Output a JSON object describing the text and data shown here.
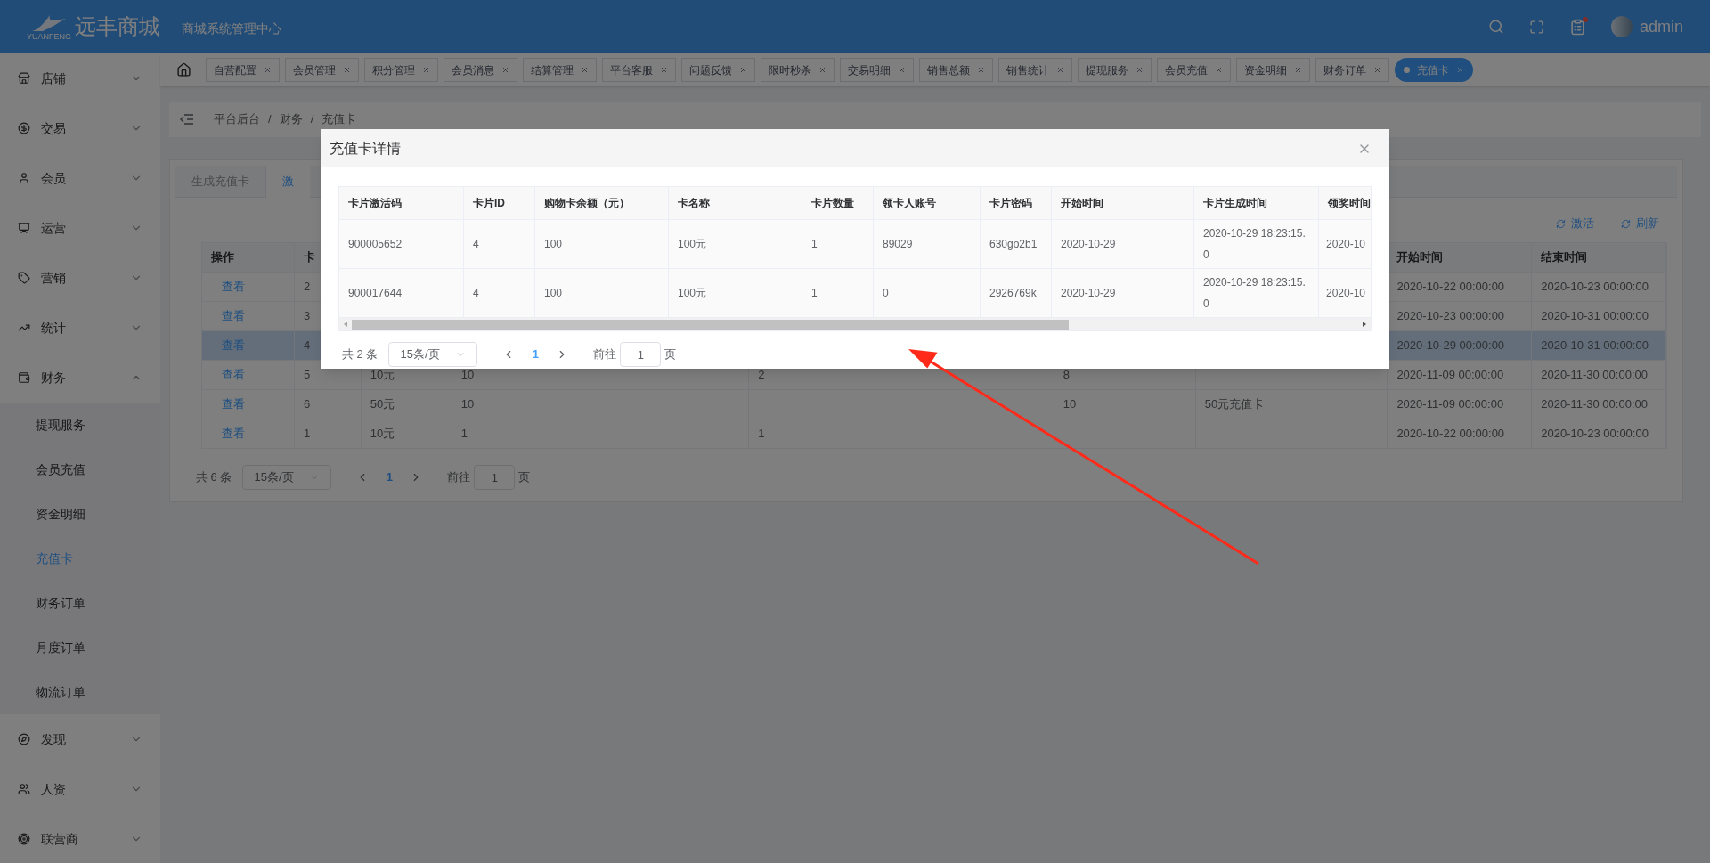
{
  "header": {
    "logo_caption": "YUANFENG",
    "logo_text": "远丰商城",
    "subtitle": "商城系统管理中心",
    "user": "admin",
    "has_notification": true
  },
  "tabs": [
    {
      "label": "自营配置",
      "selected": false
    },
    {
      "label": "会员管理",
      "selected": false
    },
    {
      "label": "积分管理",
      "selected": false
    },
    {
      "label": "会员消息",
      "selected": false
    },
    {
      "label": "结算管理",
      "selected": false
    },
    {
      "label": "平台客服",
      "selected": false
    },
    {
      "label": "问题反馈",
      "selected": false
    },
    {
      "label": "限时秒杀",
      "selected": false
    },
    {
      "label": "交易明细",
      "selected": false
    },
    {
      "label": "销售总额",
      "selected": false
    },
    {
      "label": "销售统计",
      "selected": false
    },
    {
      "label": "提现服务",
      "selected": false
    },
    {
      "label": "会员充值",
      "selected": false
    },
    {
      "label": "资金明细",
      "selected": false
    },
    {
      "label": "财务订单",
      "selected": false
    },
    {
      "label": "充值卡",
      "selected": true
    }
  ],
  "sidebar": [
    {
      "label": "店铺",
      "expanded": false
    },
    {
      "label": "交易",
      "expanded": false
    },
    {
      "label": "会员",
      "expanded": false
    },
    {
      "label": "运营",
      "expanded": false
    },
    {
      "label": "营销",
      "expanded": false
    },
    {
      "label": "统计",
      "expanded": false
    },
    {
      "label": "财务",
      "expanded": true,
      "children": [
        {
          "label": "提现服务",
          "selected": false
        },
        {
          "label": "会员充值",
          "selected": false
        },
        {
          "label": "资金明细",
          "selected": false
        },
        {
          "label": "充值卡",
          "selected": true
        },
        {
          "label": "财务订单",
          "selected": false
        },
        {
          "label": "月度订单",
          "selected": false
        },
        {
          "label": "物流订单",
          "selected": false
        }
      ]
    },
    {
      "label": "发现",
      "expanded": false
    },
    {
      "label": "人资",
      "expanded": false
    },
    {
      "label": "联营商",
      "expanded": false
    }
  ],
  "breadcrumb": [
    "平台后台",
    "财务",
    "充值卡"
  ],
  "breadcrumb_separator": "/",
  "panel": {
    "tabs": [
      {
        "label": "生成充值卡",
        "selected": false
      },
      {
        "label": "激",
        "selected": true
      }
    ],
    "actions": [
      "激活",
      "刷新"
    ],
    "table": {
      "columns": [
        "操作",
        "卡",
        null,
        null,
        null,
        null,
        null,
        "开始时间",
        "结束时间"
      ],
      "rows": [
        {
          "highlighted": false,
          "cells": [
            "查看",
            "2",
            null,
            null,
            null,
            null,
            null,
            "2020-10-22 00:00:00",
            "2020-10-23 00:00:00"
          ]
        },
        {
          "highlighted": false,
          "cells": [
            "查看",
            "3",
            null,
            null,
            null,
            null,
            null,
            "2020-10-23 00:00:00",
            "2020-10-31 00:00:00"
          ]
        },
        {
          "highlighted": true,
          "cells": [
            "查看",
            "4",
            null,
            null,
            null,
            null,
            null,
            "2020-10-29 00:00:00",
            "2020-10-31 00:00:00"
          ]
        },
        {
          "highlighted": false,
          "cells": [
            "查看",
            "5",
            "10元",
            "10",
            "2",
            "8",
            null,
            "2020-11-09 00:00:00",
            "2020-11-30 00:00:00"
          ]
        },
        {
          "highlighted": false,
          "cells": [
            "查看",
            "6",
            "50元",
            "10",
            null,
            "10",
            "50元充值卡",
            "2020-11-09 00:00:00",
            "2020-11-30 00:00:00"
          ]
        },
        {
          "highlighted": false,
          "cells": [
            "查看",
            "1",
            "10元",
            "1",
            "1",
            null,
            null,
            "2020-10-22 00:00:00",
            "2020-10-23 00:00:00"
          ]
        }
      ]
    },
    "pagination": {
      "total": "共 6 条",
      "page_size": "15条/页",
      "page": "1",
      "goto": "前往",
      "goto_value": "1",
      "unit": "页"
    }
  },
  "dialog": {
    "title": "充值卡详情",
    "columns": [
      "卡片激活码",
      "卡片ID",
      "购物卡余额（元）",
      "卡名称",
      "卡片数量",
      "领卡人账号",
      "卡片密码",
      "开始时间",
      "卡片生成时间",
      "领奖时间"
    ],
    "rows": [
      [
        "900005652",
        "4",
        "100",
        "100元",
        "1",
        "89029",
        "630go2b1",
        "2020-10-29",
        "2020-10-29 18:23:15.0",
        "2020-10"
      ],
      [
        "900017644",
        "4",
        "100",
        "100元",
        "1",
        "0",
        "2926769k",
        "2020-10-29",
        "2020-10-29 18:23:15.0",
        "2020-10"
      ]
    ],
    "pagination": {
      "total": "共 2 条",
      "page_size": "15条/页",
      "page": "1",
      "goto": "前往",
      "goto_value": "1",
      "unit": "页"
    }
  }
}
